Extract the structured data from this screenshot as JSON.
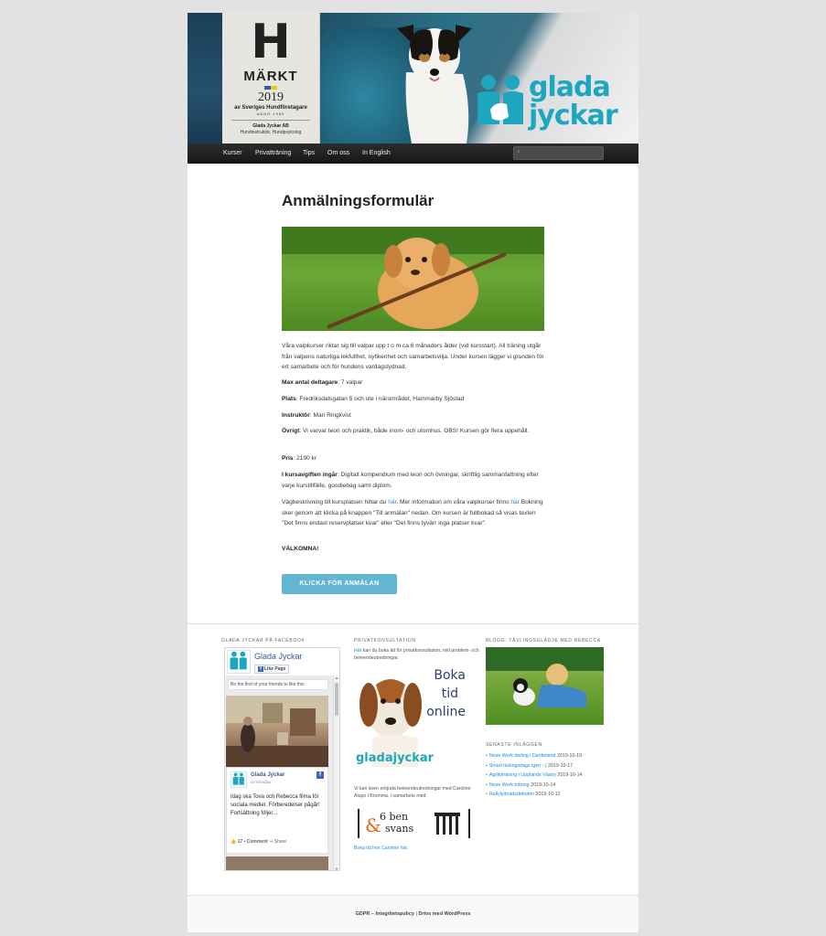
{
  "header": {
    "badge_letter": "H",
    "badge_markt": "MÄRKT",
    "badge_year": "2019",
    "badge_assoc": "av Sveriges Hundföretagare",
    "badge_anno": "ANNO 1983",
    "badge_company": "Glada Jyckar AB",
    "badge_role": "Hundinstruktör, Hundpsykolog",
    "logo_line1": "glada",
    "logo_line2": "jyckar"
  },
  "nav": {
    "items": [
      "Kurser",
      "Privatträning",
      "Tips",
      "Om oss",
      "In English"
    ]
  },
  "main": {
    "title": "Anmälningsformulär",
    "intro": "Våra valpkurser riktar sig till valpar upp t o m ca 6 månaders ålder (vid kursstart). All träning utgår från valpens naturliga lekfullhet, nyfikenhet och samarbetsvilja. Under kursen lägger vi grunden för ert samarbete och för hundens vardagslydnad.",
    "max_label": "Max antal deltagare",
    "max_value": ": 7 valpar",
    "plats_label": "Plats",
    "plats_value": ": Fredriksdalsgatan 5 och ute i närområdet, Hammarby Sjöstad",
    "instr_label": "Instruktör",
    "instr_value": ": Mari Ringkvist",
    "ovrigt_label": "Övrigt",
    "ovrigt_value": ": Vi varvar teori och praktik, både inom- och utomhus. OBS! Kursen gör flera uppehåll.",
    "pris_label": "Pris",
    "pris_value": ": 2190 kr",
    "ingar_label": "I kursavgiften ingår",
    "ingar_value": ": Digitalt kompendium med teori och övningar, skriftlig sammanfattning efter varje kurstillfälle, goodiebag samt diplom.",
    "vag_text1": "Vägbeskrivning till kursplatsen hittar du ",
    "vag_link1": "här",
    "vag_text2": ". Mer information om våra valpkurser finns ",
    "vag_link2": "här",
    "vag_text3": " Bokning sker genom att klicka på knappen \"Till anmälan\" nedan. Om kursen är fullbokad så visas texten \"Det finns endast reservplatser kvar\" eller \"Det finns tyvärr inga platser kvar\".",
    "valkomna": "VÄLKOMNA!",
    "cta_label": "KLICKA FÖR ANMÄLAN"
  },
  "widgets": {
    "facebook_title": "GLADA JYCKAR PÅ FACEBOOK",
    "fb_page_name": "Glada Jyckar",
    "fb_like": "Like Page",
    "fb_friends": "Be the first of your friends to like this",
    "fb_post_author": "Glada Jyckar",
    "fb_post_date": "on Monday",
    "fb_post_text": "Idag ska Tova och Rebecca filma för sociala medier. Förberedelser pågår! Fortsättning följer...",
    "fb_likes_count": "17",
    "fb_comment": "Comment",
    "fb_share": "Share",
    "priv_title": "PRIVATKONSULTATION",
    "priv_link": "Här",
    "priv_text": " kan du boka tid för privatkonsultation, inkl problem- och beteendeutredningar.",
    "ad_line1": "Boka",
    "ad_line2": "tid",
    "ad_line3": "online",
    "ad_logo": "gladajyckar",
    "priv_text2": "Vi kan även erbjuda beteendeutredningar med Caroline Alupo i Bromma, i samarbete med:",
    "ben_logo_line1": "6 ben",
    "ben_logo_line2": "svans",
    "ben_logo_amp": "&",
    "priv_link2": "Boka tid hos Caroline här.",
    "blog_title": "BLOGG: TÄVLINGSGLÄDJE MED REBECCA",
    "recent_title": "SENASTE INLÄGGEN",
    "recent": [
      {
        "title": "Nose Work tävling i Danboland",
        "date": "2019-10-19"
      },
      {
        "title": "Smarl tävlingsdags igen :-)",
        "date": "2019-10-17"
      },
      {
        "title": "Agilityträning i Upplands Väsby",
        "date": "2019-10-14"
      },
      {
        "title": "Nose Work träning",
        "date": "2019-10-14"
      },
      {
        "title": "Rallylydnadsdebuten",
        "date": "2019-10-12"
      }
    ]
  },
  "footer": {
    "gdpr": "GDPR – Integritetspolicy",
    "sep": " | ",
    "wp": "Drivs med WordPress"
  },
  "colors": {
    "accent": "#63b6d1",
    "brand": "#1ea6bf",
    "link": "#1b8be0"
  }
}
